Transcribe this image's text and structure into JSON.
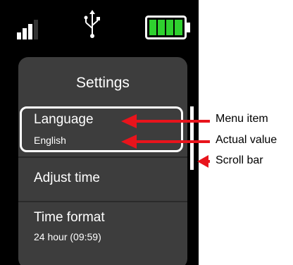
{
  "screen": {
    "title": "Settings",
    "menu": [
      {
        "label": "Language",
        "value": "English",
        "selected": true
      },
      {
        "label": "Adjust time",
        "value": "",
        "selected": false
      },
      {
        "label": "Time format",
        "value": "24 hour (09:59)",
        "selected": false
      }
    ]
  },
  "status_bar": {
    "signal_icon": "signal-bars-icon",
    "usb_icon": "usb-icon",
    "battery_icon": "battery-full-icon",
    "battery_color": "#2fd12f"
  },
  "annotations": {
    "menu_item": "Menu item",
    "actual_value": "Actual value",
    "scroll_bar": "Scroll bar",
    "arrow_color": "#e8141c"
  }
}
